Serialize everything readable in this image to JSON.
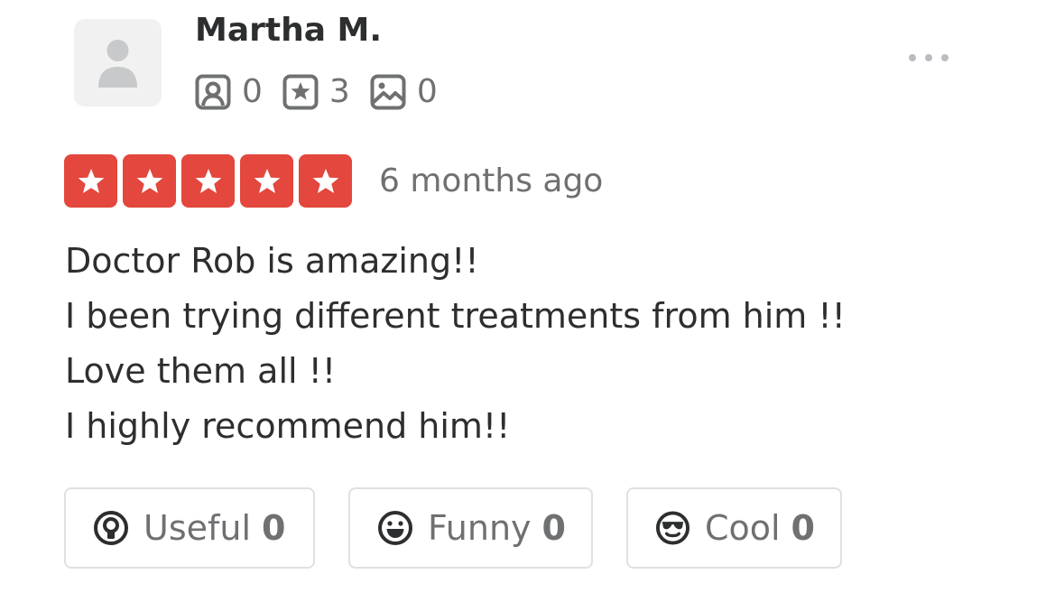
{
  "reviewer": {
    "name": "Martha M.",
    "stats": {
      "friends": "0",
      "reviews": "3",
      "photos": "0"
    }
  },
  "review": {
    "rating": 5,
    "date": "6 months ago",
    "lines": [
      "Doctor Rob is amazing!!",
      "I been trying different treatments from him !!",
      "Love them all !!",
      "I highly recommend him!!"
    ]
  },
  "reactions": {
    "useful": {
      "label": "Useful",
      "count": "0"
    },
    "funny": {
      "label": "Funny",
      "count": "0"
    },
    "cool": {
      "label": "Cool",
      "count": "0"
    }
  },
  "icons": {
    "avatar": "user-silhouette-icon",
    "friends": "friends-icon",
    "reviews": "review-star-icon",
    "photos": "photo-icon",
    "more": "more-options-icon",
    "useful": "lightbulb-icon",
    "funny": "smile-icon",
    "cool": "sunglasses-icon"
  },
  "colors": {
    "star_red": "#e3473d",
    "text_dark": "#2d2e2f",
    "text_gray": "#6e7072",
    "border": "#e0e0e0"
  }
}
